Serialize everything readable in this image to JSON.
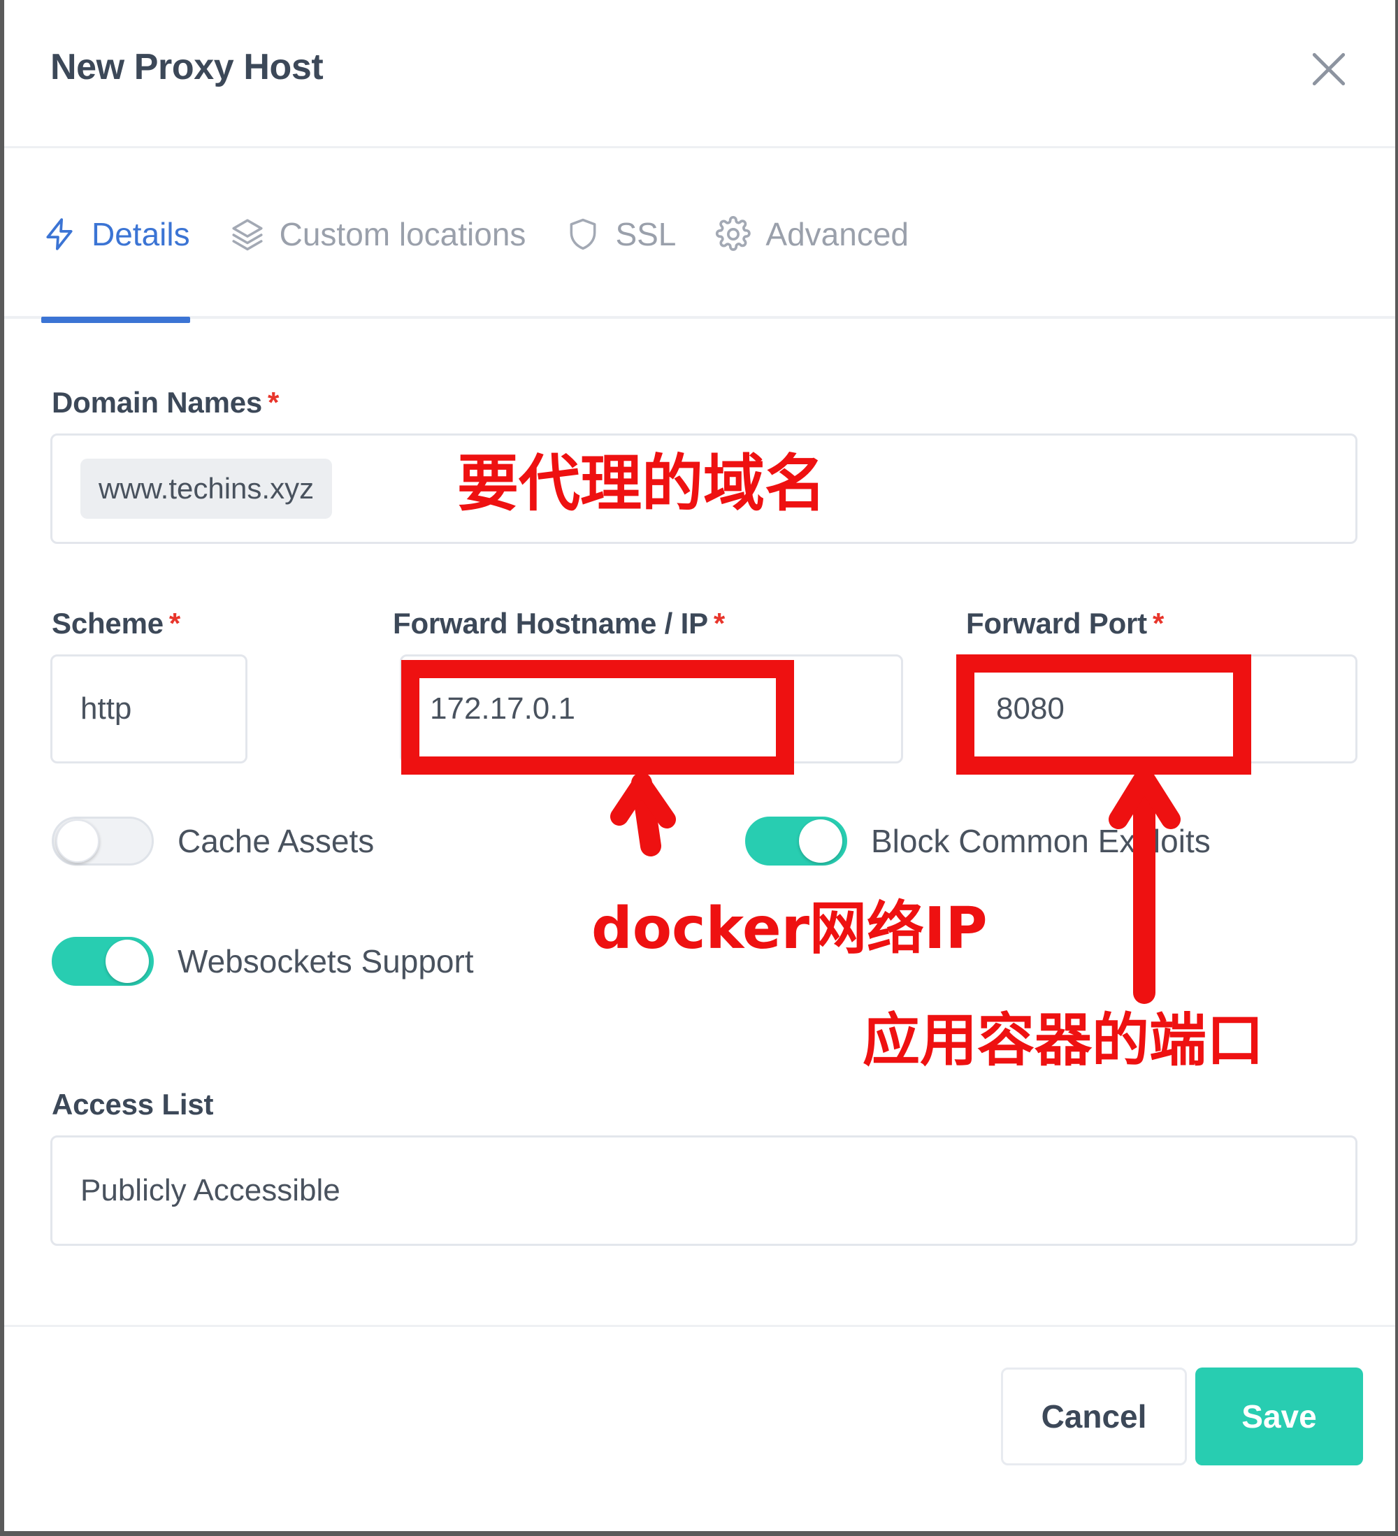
{
  "header": {
    "title": "New Proxy Host",
    "close_icon": "close-icon"
  },
  "tabs": [
    {
      "label": "Details",
      "icon": "bolt-icon",
      "active": true
    },
    {
      "label": "Custom locations",
      "icon": "layers-icon",
      "active": false
    },
    {
      "label": "SSL",
      "icon": "shield-icon",
      "active": false
    },
    {
      "label": "Advanced",
      "icon": "gear-icon",
      "active": false
    }
  ],
  "form": {
    "domain_names": {
      "label": "Domain Names",
      "required_mark": "*",
      "tags": [
        "www.techins.xyz"
      ]
    },
    "scheme": {
      "label": "Scheme",
      "required_mark": "*",
      "value": "http"
    },
    "forward_hostname": {
      "label": "Forward Hostname / IP",
      "required_mark": "*",
      "value": "172.17.0.1"
    },
    "forward_port": {
      "label": "Forward Port",
      "required_mark": "*",
      "value": "8080"
    },
    "toggles": [
      {
        "label": "Cache Assets",
        "state": "off"
      },
      {
        "label": "Block Common Exploits",
        "state": "on"
      },
      {
        "label": "Websockets Support",
        "state": "on"
      }
    ],
    "access_list": {
      "label": "Access List",
      "value": "Publicly Accessible"
    }
  },
  "footer": {
    "cancel_label": "Cancel",
    "save_label": "Save"
  },
  "annotations": {
    "domain_note": "要代理的域名",
    "docker_ip_note": "docker网络IP",
    "container_port_note": "应用容器的端口"
  },
  "colors": {
    "accent_blue": "#3b74d4",
    "toggle_on_teal": "#28cdb1",
    "save_teal": "#28cdb1",
    "annotation_red": "#ee1111",
    "required_red": "#e8352b",
    "text_dark": "#3c4858",
    "text_muted": "#9aa0ab"
  }
}
